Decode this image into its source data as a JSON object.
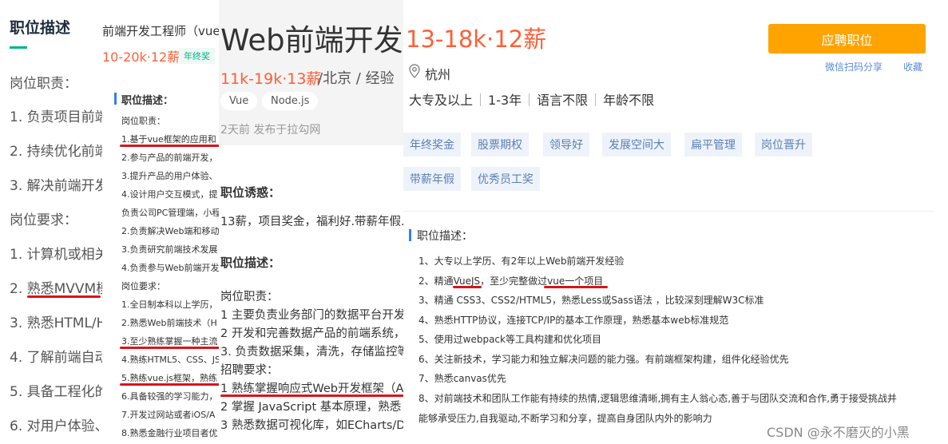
{
  "panel1": {
    "title": "职位描述",
    "lines": [
      "岗位职责：",
      "1. 负责项目前端",
      "2. 持续优化前端",
      "3. 解决前端开发",
      "岗位要求：",
      "1. 计算机或相关",
      "2. 熟悉MVVM模",
      "3. 熟悉HTML/H",
      "4. 了解前端自动",
      "5. 具备工程化的",
      "6. 对用户体验、"
    ]
  },
  "panel2": {
    "job_title": "前端开发工程师（vue",
    "salary": "10-20k·12薪",
    "tag": "年终奖",
    "desc_heading": "职位描述：",
    "lines": [
      "岗位职责：",
      "1.基于vue框架的应用和",
      "2.参与产品的前端开发，",
      "3.提升产品的用户体验、",
      "4.设计用户交互模式，提",
      "负责公司PC管理端，小程",
      "2.负责解决Web端和移动",
      "3.负责研究前端技术发展",
      "4.负责参与Web前端开发",
      "岗位要求：",
      "1.全日制本科以上学历，",
      "2.熟悉Web前端技术（H",
      "3.至少熟练掌握一种主流",
      "4.熟练HTML5、CSS、JS",
      "5.熟练vue.js框架，熟练",
      "6.具备较强的学习能力，",
      "7.开发过网站或者iOS/A",
      "8.熟悉金融行业项目者优"
    ]
  },
  "panel3": {
    "big_title": "Web前端开发",
    "salary": "11k-19k·13薪",
    "location": "/北京 / 经验",
    "chips": [
      "Vue",
      "Node.js"
    ],
    "time": "2天前  发布于拉勾网",
    "temptation_heading": "职位诱惑：",
    "temptation_text": "13薪，项目奖金，福利好.带薪年假.",
    "desc_heading": "职位描述：",
    "lines": [
      "岗位职责：",
      "1 主要负责业务部门的数据平台开发",
      "2 开发和完善数据产品的前端系统，",
      "3. 负责数据采集，清洗，存储监控等",
      "招聘要求：",
      "1 熟练掌握响应式Web开发框架（A",
      "2 掌握 JavaScript 基本原理，熟悉 I",
      "3 熟悉数据可视化库，如ECharts/D"
    ]
  },
  "panel4": {
    "salary": "13-18k·12薪",
    "apply_label": "应聘职位",
    "share_label": "微信扫码分享",
    "favorite_label": "收藏",
    "city": "杭州",
    "requirements": [
      "大专及以上",
      "1-3年",
      "语言不限",
      "年龄不限"
    ],
    "welfare": [
      "年终奖金",
      "股票期权",
      "领导好",
      "发展空间大",
      "扁平管理",
      "岗位晋升",
      "带薪年假",
      "优秀员工奖"
    ],
    "desc_heading": "职位描述：",
    "lines": [
      "1、大专以上学历、有2年以上Web前端开发经验",
      "2、精通VueJS，至少完整做过vue一个项目",
      "3、精通 CSS3、CSS2/HTML5，熟悉Less或Sass语法 ，比较深刻理解W3C标准",
      "4、熟悉HTTP协议，连接TCP/IP的基本工作原理，熟悉基本web标准规范",
      "5、使用过webpack等工具构建和优化项目",
      "6、关注新技术，学习能力和独立解决问题的能力强。有前端框架构建，组件化经验优先",
      "7、熟悉canvas优先",
      "8、对前端技术和团队工作能有持续的热情,逻辑思维清晰,拥有主人翁心态,善于与团队交流和合作,勇于接受挑战并",
      "能够承受压力,自我驱动,不断学习和分享，提高自身团队内外的影响力"
    ],
    "watermark": "CSDN @永不磨灭的小黑"
  },
  "colors": {
    "salary": "#fd5f39",
    "apply": "#ffa300",
    "highlight": "#d9141b",
    "accent": "#00b38a"
  }
}
